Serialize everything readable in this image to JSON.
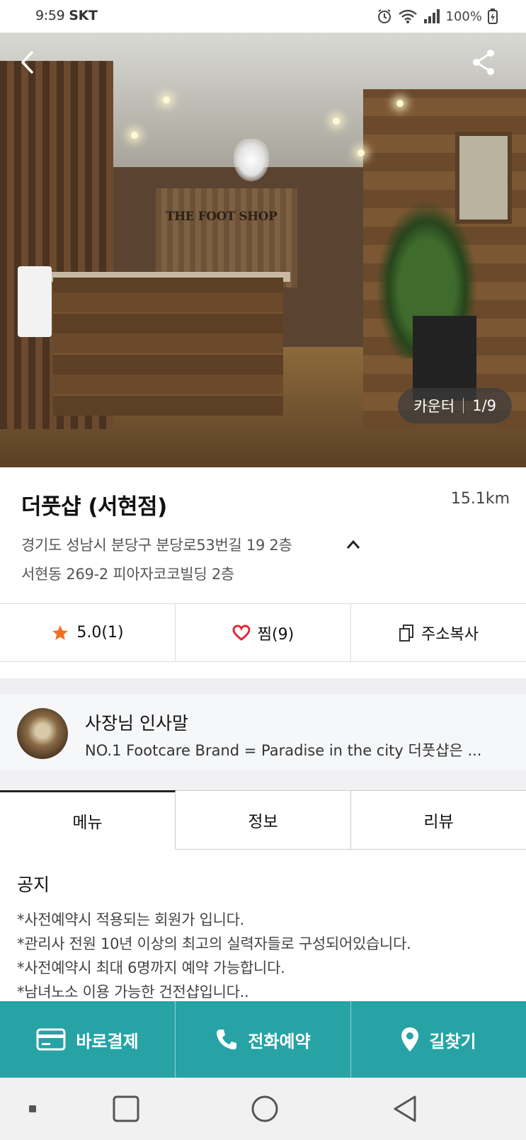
{
  "status_bar": {
    "time": "9:59",
    "carrier": "SKT",
    "battery": "100%"
  },
  "photo": {
    "caption": "카운터",
    "counter": "1/9",
    "sign_text": "THE FOOT SHOP"
  },
  "store": {
    "name": "더풋샵 (서현점)",
    "distance": "15.1km",
    "address_road": "경기도 성남시 분당구 분당로53번길 19 2층",
    "address_lot": "서현동 269-2 피아자코코빌딩 2층"
  },
  "actions": {
    "rating": "5.0(1)",
    "favorite": "찜(9)",
    "copy_address": "주소복사"
  },
  "greeting": {
    "title": "사장님 인사말",
    "text": "NO.1 Footcare Brand = Paradise in the city  더풋샵은 ..."
  },
  "tabs": [
    {
      "label": "메뉴",
      "active": true
    },
    {
      "label": "정보",
      "active": false
    },
    {
      "label": "리뷰",
      "active": false
    }
  ],
  "notice": {
    "title": "공지",
    "lines": [
      "*사전예약시 적용되는 회원가 입니다.",
      "*관리사 전원 10년 이상의 최고의 실력자들로 구성되어있습니다.",
      "*사전예약시 최대 6명까지 예약 가능합니다.",
      "*남녀노소 이용 가능한 건전샵입니다.."
    ]
  },
  "cta": {
    "pay": "바로결제",
    "call": "전화예약",
    "directions": "길찾기"
  },
  "colors": {
    "accent": "#27a3a6",
    "star": "#f37021",
    "heart": "#e5263a"
  },
  "icons": [
    "back-icon",
    "share-icon",
    "star-icon",
    "heart-icon",
    "copy-icon",
    "chevron-up-icon",
    "card-icon",
    "phone-icon",
    "location-pin-icon"
  ]
}
